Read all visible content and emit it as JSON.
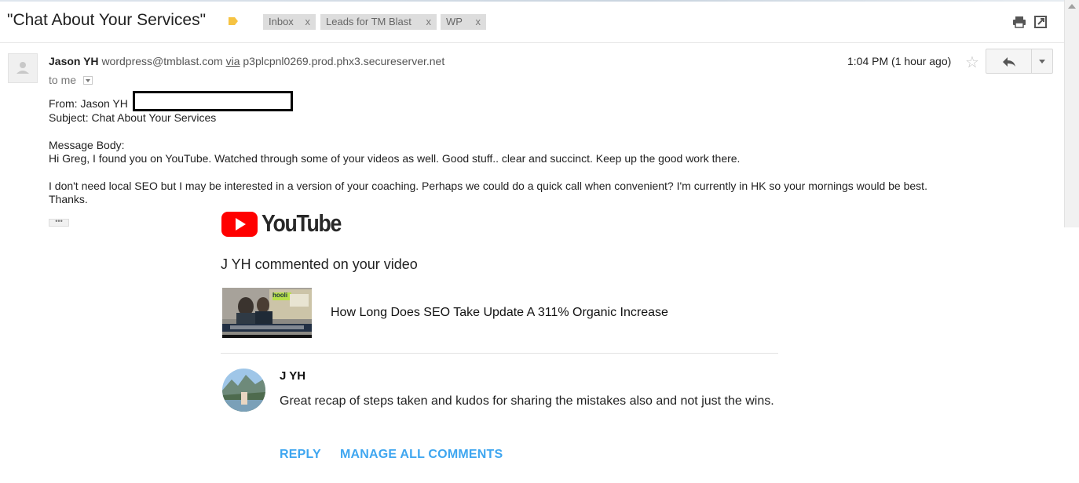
{
  "thread": {
    "subject": "\"Chat About Your Services\"",
    "labels": [
      {
        "name": "Inbox",
        "remove": "x"
      },
      {
        "name": "Leads for TM Blast",
        "remove": "x"
      },
      {
        "name": "WP",
        "remove": "x"
      }
    ],
    "icons": {
      "label": "label-tag-icon",
      "print": "print-icon",
      "new_window": "open-in-new-window-icon"
    }
  },
  "message": {
    "sender_name": "Jason YH",
    "sender_email": "wordpress@tmblast.com",
    "via_label": "via",
    "via_server": "p3plcpnl0269.prod.phx3.secureserver.net",
    "recipient": "to me",
    "time": "1:04 PM (1 hour ago)",
    "body": {
      "from_line": "From: Jason YH",
      "subject_line": "Subject: Chat About Your Services",
      "message_label": "Message Body:",
      "paragraph1": "Hi Greg, I found you on YouTube. Watched through some of your videos as well. Good stuff.. clear and succinct. Keep up the good work there.",
      "paragraph2_line1": "I don't need local SEO but I may be interested in a version of your coaching. Perhaps we could do a quick call when convenient? I'm currently in HK so your mornings would be best.",
      "paragraph2_line2": "Thanks.",
      "ellipsis": "•••"
    }
  },
  "youtube": {
    "logo_text": "YouTube",
    "headline": "J YH commented on your video",
    "video_title": "How Long Does SEO Take Update A 311% Organic Increase",
    "thumbnail_text": "hooli",
    "commenter": "J YH",
    "comment": "Great recap of steps taken and kudos for sharing the mistakes also and not just the wins.",
    "reply_label": "REPLY",
    "manage_label": "MANAGE ALL COMMENTS"
  },
  "colors": {
    "youtube_red": "#ff0000",
    "link_blue": "#3ea6f0",
    "label_yellow": "#f6c342",
    "chip_bg": "#dddddd"
  }
}
